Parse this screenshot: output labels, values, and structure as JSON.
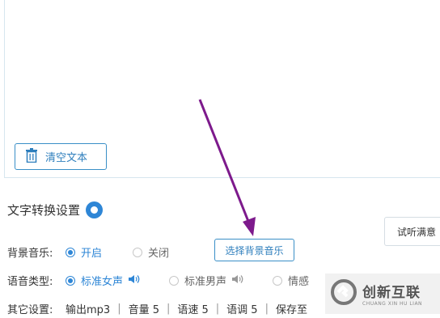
{
  "text_area": {
    "clear_button_label": "清空文本"
  },
  "settings": {
    "title": "文字转换设置",
    "background_music": {
      "label": "背景音乐:",
      "on": "开启",
      "off": "关闭",
      "choose_button": "选择背景音乐",
      "selected": "on"
    },
    "voice_type": {
      "label": "语音类型:",
      "options": [
        "标准女声",
        "标准男声",
        "情感"
      ],
      "selected": "标准女声"
    },
    "other": {
      "label": "其它设置:",
      "items": [
        "输出mp3",
        "音量 5",
        "语速 5",
        "语调 5",
        "保存至"
      ]
    }
  },
  "preview_button": "试听满意",
  "watermark": {
    "name": "创新互联",
    "sub": "CHUANG XIN HU LIAN"
  },
  "colors": {
    "accent": "#2e86d6",
    "arrow": "#7d1a8c"
  }
}
